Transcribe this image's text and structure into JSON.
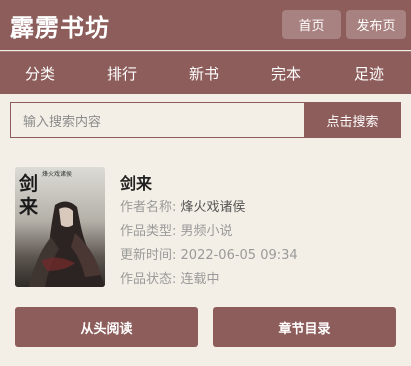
{
  "header": {
    "site_title": "霹雳书坊",
    "home_label": "首页",
    "post_label": "发布页"
  },
  "nav": {
    "items": [
      "分类",
      "排行",
      "新书",
      "完本",
      "足迹"
    ]
  },
  "search": {
    "placeholder": "输入搜索内容",
    "button_label": "点击搜索"
  },
  "book": {
    "title": "剑来",
    "cover_title": "剑来",
    "cover_author": "烽火戏诸侯",
    "author_label": "作者名称:",
    "author": "烽火戏诸侯",
    "type_label": "作品类型:",
    "type": "男频小说",
    "updated_label": "更新时间:",
    "updated": "2022-06-05 09:34",
    "status_label": "作品状态:",
    "status": "连载中"
  },
  "actions": {
    "read_label": "从头阅读",
    "chapters_label": "章节目录"
  },
  "colors": {
    "brand": "#8d5d5b",
    "background": "#f4efe6"
  }
}
